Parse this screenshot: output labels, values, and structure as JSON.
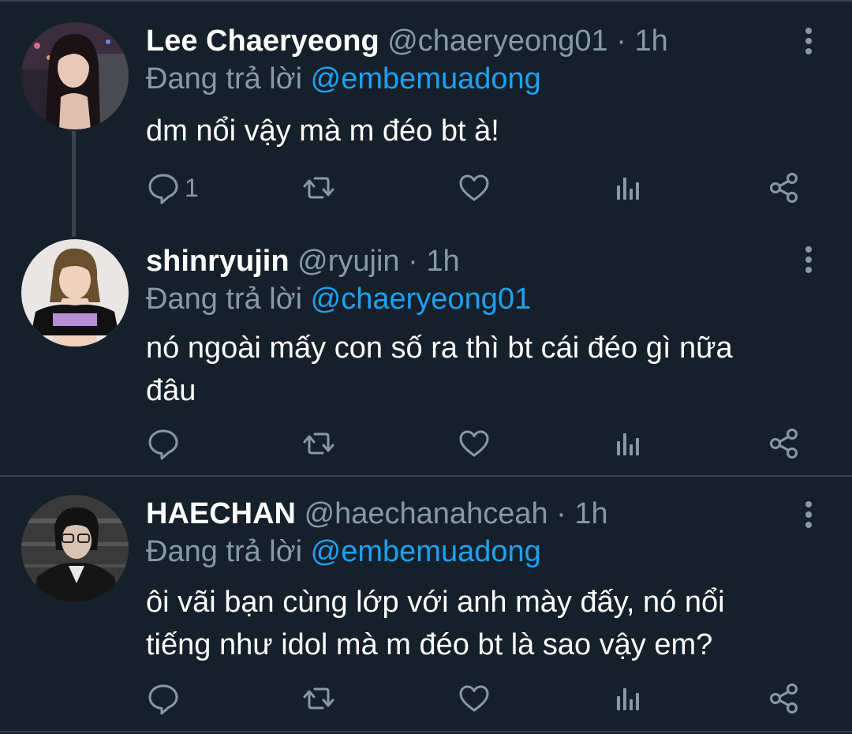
{
  "tweets": [
    {
      "name": "Lee Chaeryeong",
      "handle": "@chaeryeong01",
      "sep": "·",
      "time": "1h",
      "replying_label": "Đang trả lời",
      "replying_to": "@embemuadong",
      "text": "dm nổi vậy mà m đéo bt à!",
      "reply_count": "1",
      "avatar": "woman-with-long-dark-hair-photo"
    },
    {
      "name": "shinryujin",
      "handle": "@ryujin",
      "sep": "·",
      "time": "1h",
      "replying_label": "Đang trả lời",
      "replying_to": "@chaeryeong01",
      "text": "nó ngoài mấy con số ra thì bt cái đéo gì nữa đâu",
      "reply_count": "",
      "avatar": "woman-in-black-crop-top-photo"
    },
    {
      "name": "HAECHAN",
      "handle": "@haechanahceah",
      "sep": "·",
      "time": "1h",
      "replying_label": "Đang trả lời",
      "replying_to": "@embemuadong",
      "text": "ôi vãi bạn cùng lớp với anh mày đấy, nó nổi tiếng như idol mà m đéo bt là sao vậy em?",
      "reply_count": "",
      "avatar": "man-with-glasses-photo"
    }
  ],
  "icons": {
    "reply": "reply-icon",
    "retweet": "retweet-icon",
    "like": "heart-icon",
    "stats": "analytics-icon",
    "share": "share-icon",
    "more": "more-vertical-icon"
  },
  "colors": {
    "background": "#15202b",
    "text": "#ffffff",
    "secondary": "#8899a6",
    "accent": "#1da1f2",
    "divider": "#38444d"
  }
}
